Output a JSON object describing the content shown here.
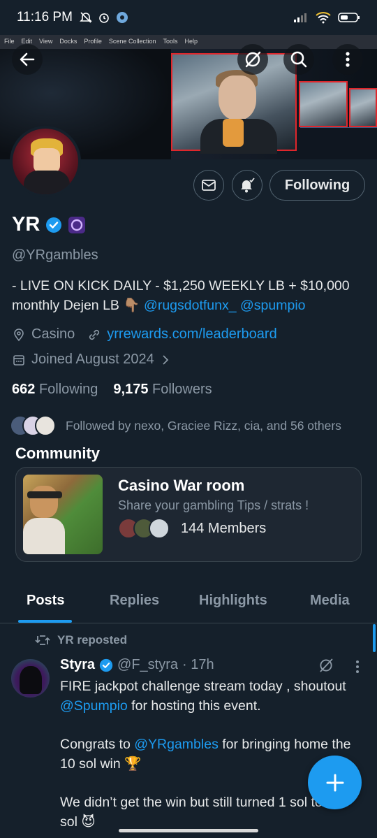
{
  "status_bar": {
    "time": "11:16 PM"
  },
  "banner": {
    "obs_menu": [
      "File",
      "Edit",
      "View",
      "Docks",
      "Profile",
      "Scene Collection",
      "Tools",
      "Help"
    ]
  },
  "profile": {
    "name": "YR",
    "handle": "@YRgambles",
    "bio_text": "- LIVE ON KICK DAILY - $1,250 WEEKLY LB + $10,000 monthly Dejen LB 👇🏽 ",
    "bio_mention1": "@rugsdotfunx_",
    "bio_mention2": "@spumpio",
    "location": "Casino",
    "website": "yrrewards.com/leaderboard",
    "joined": "Joined August 2024",
    "following_count": "662",
    "following_label": "Following",
    "followers_count": "9,175",
    "followers_label": "Followers",
    "followed_by": "Followed by nexo, Graciee Rizz, cia, and 56 others",
    "follow_button": "Following"
  },
  "community": {
    "section_title": "Community",
    "name": "Casino War room",
    "description": "Share your gambling Tips / strats !",
    "members": "144 Members"
  },
  "tabs": [
    "Posts",
    "Replies",
    "Highlights",
    "Media"
  ],
  "post": {
    "repost_label": "YR reposted",
    "author_name": "Styra",
    "author_handle": "@F_styra",
    "time": "· 17h",
    "line1_a": "FIRE jackpot challenge stream today , shoutout ",
    "line1_mention": "@Spumpio",
    "line1_b": " for hosting this event.",
    "line2_a": "Congrats to ",
    "line2_mention": "@YRgambles",
    "line2_b": " for bringing home the 10 sol win 🏆",
    "line3": "We didn’t get the win but still turned 1 sol to 10 sol 😈"
  },
  "colors": {
    "background": "#15202b",
    "accent": "#1d9bf0",
    "muted": "#8b98a5"
  }
}
